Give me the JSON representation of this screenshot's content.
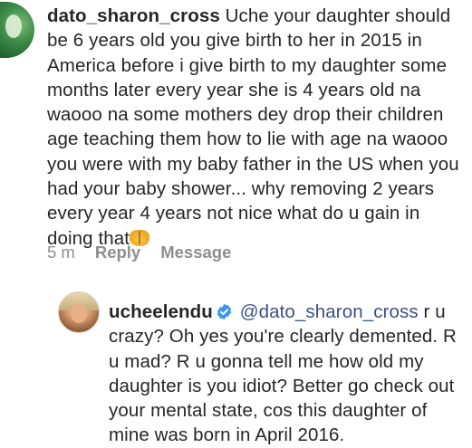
{
  "comment": {
    "username": "dato_sharon_cross",
    "text": "Uche your daughter should be 6 years old you give birth to her in 2015 in America before i give birth to my daughter some months later every year she is 4 years old na waooo na some mothers dey drop their children age teaching them how to lie with age na waooo you were with my baby father in the US when you had your baby shower... why removing 2 years every year 4 years not nice what do u gain in doing that",
    "emoji": "raised-hands-emoji",
    "time": "5 m",
    "reply_label": "Reply",
    "message_label": "Message"
  },
  "reply": {
    "username": "ucheelendu",
    "verified_icon": "verified-badge-icon",
    "mention": "@dato_sharon_cross",
    "text": "r u crazy? Oh yes you're clearly demented. R u mad? R u gonna tell me how old my daughter is you idiot? Better go check out your mental state, cos this daughter of mine was born in April 2016."
  },
  "colors": {
    "text": "#262626",
    "meta": "#8e8e8e",
    "mention": "#385185",
    "verified": "#3897f0"
  }
}
